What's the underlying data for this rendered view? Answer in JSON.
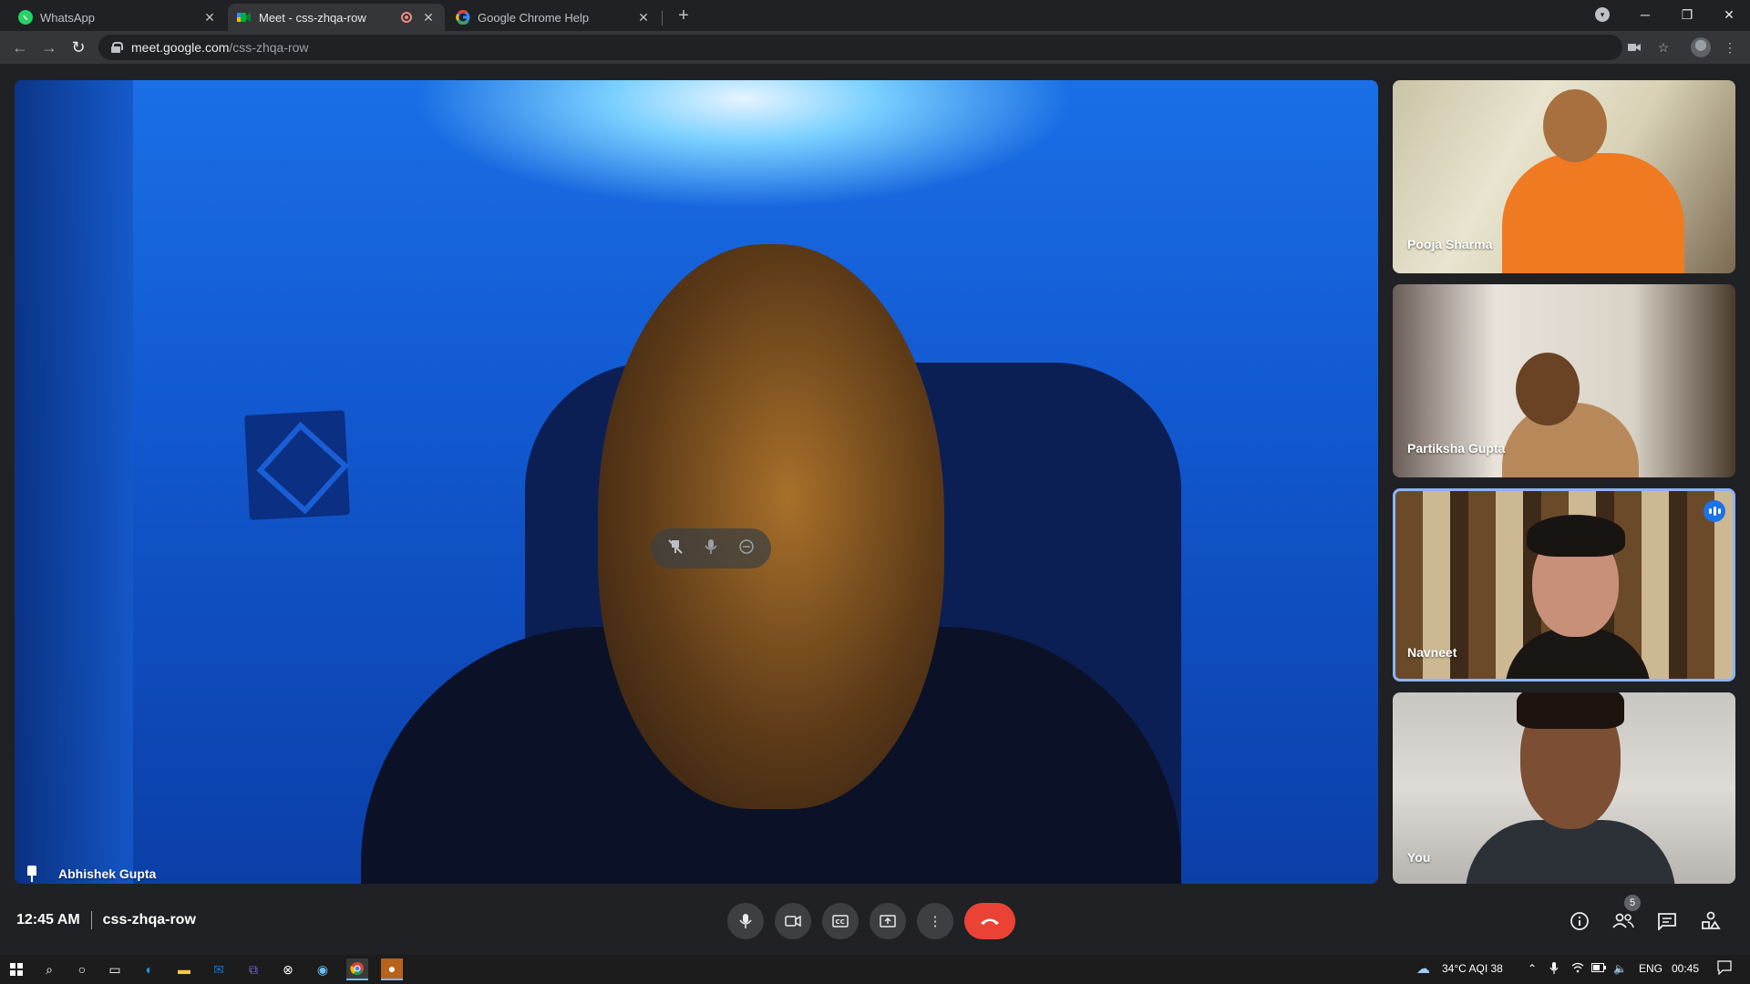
{
  "browser": {
    "tabs": [
      {
        "label": "WhatsApp",
        "favicon": "whatsapp-icon",
        "active": false,
        "color": "#25d366"
      },
      {
        "label": "Meet - css-zhqa-row",
        "favicon": "google-meet-icon",
        "active": true,
        "recording": true,
        "color": "#00ac47"
      },
      {
        "label": "Google Chrome Help",
        "favicon": "google-icon",
        "active": false,
        "color": "#4285f4"
      }
    ],
    "close_glyph": "✕",
    "new_tab_glyph": "+",
    "url_host": "meet.google.com",
    "url_path": "/css-zhqa-row"
  },
  "meeting": {
    "code": "css-zhqa-row",
    "time": "12:45 AM",
    "participants_count": "5",
    "main": {
      "name": "Abhishek Gupta",
      "pinned": true
    },
    "tiles": [
      {
        "name": "Pooja Sharma"
      },
      {
        "name": "Partiksha Gupta"
      },
      {
        "name": "Navneet",
        "speaking": true
      },
      {
        "name": "You"
      }
    ],
    "highlight_color": "#8ab4f8",
    "end_call_color": "#ea4335"
  },
  "taskbar": {
    "weather": "34°C  AQI 38",
    "language": "ENG",
    "clock": "00:45"
  }
}
